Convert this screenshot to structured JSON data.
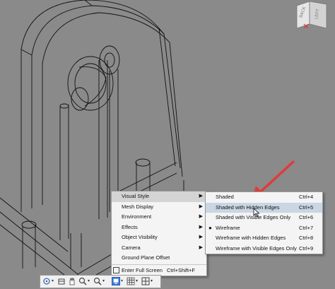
{
  "viewcube": {
    "back_label": "BACK",
    "left_label": "LEFT"
  },
  "visual_menu": {
    "items": [
      {
        "label": "Visual Style",
        "has_submenu": true,
        "highlighted": true
      },
      {
        "label": "Mesh Display",
        "has_submenu": true
      },
      {
        "label": "Environment",
        "has_submenu": true
      },
      {
        "label": "Effects",
        "has_submenu": true
      },
      {
        "label": "Object Visibility",
        "has_submenu": true
      },
      {
        "label": "Camera",
        "has_submenu": true
      },
      {
        "label": "Ground Plane Offset",
        "has_submenu": false
      }
    ],
    "full_screen_label": "Enter Full Screen",
    "full_screen_shortcut": "Ctrl+Shift+F"
  },
  "visual_style_submenu": {
    "items": [
      {
        "label": "Shaded",
        "shortcut": "Ctrl+4"
      },
      {
        "label": "Shaded with Hidden Edges",
        "shortcut": "Ctrl+5",
        "highlighted": true
      },
      {
        "label": "Shaded with Visible Edges Only",
        "shortcut": "Ctrl+6"
      },
      {
        "label": "Wireframe",
        "shortcut": "Ctrl+7",
        "selected": true
      },
      {
        "label": "Wireframe with Hidden Edges",
        "shortcut": "Ctrl+8"
      },
      {
        "label": "Wireframe with Visible Edges Only",
        "shortcut": "Ctrl+9"
      }
    ]
  },
  "annotation_color": "#e23a3a",
  "toolbar_icons": [
    "orbit-icon",
    "look-at-icon",
    "pan-icon",
    "zoom-icon",
    "zoom-window-icon",
    "display-settings-icon",
    "grid-icon",
    "view-layout-icon"
  ]
}
